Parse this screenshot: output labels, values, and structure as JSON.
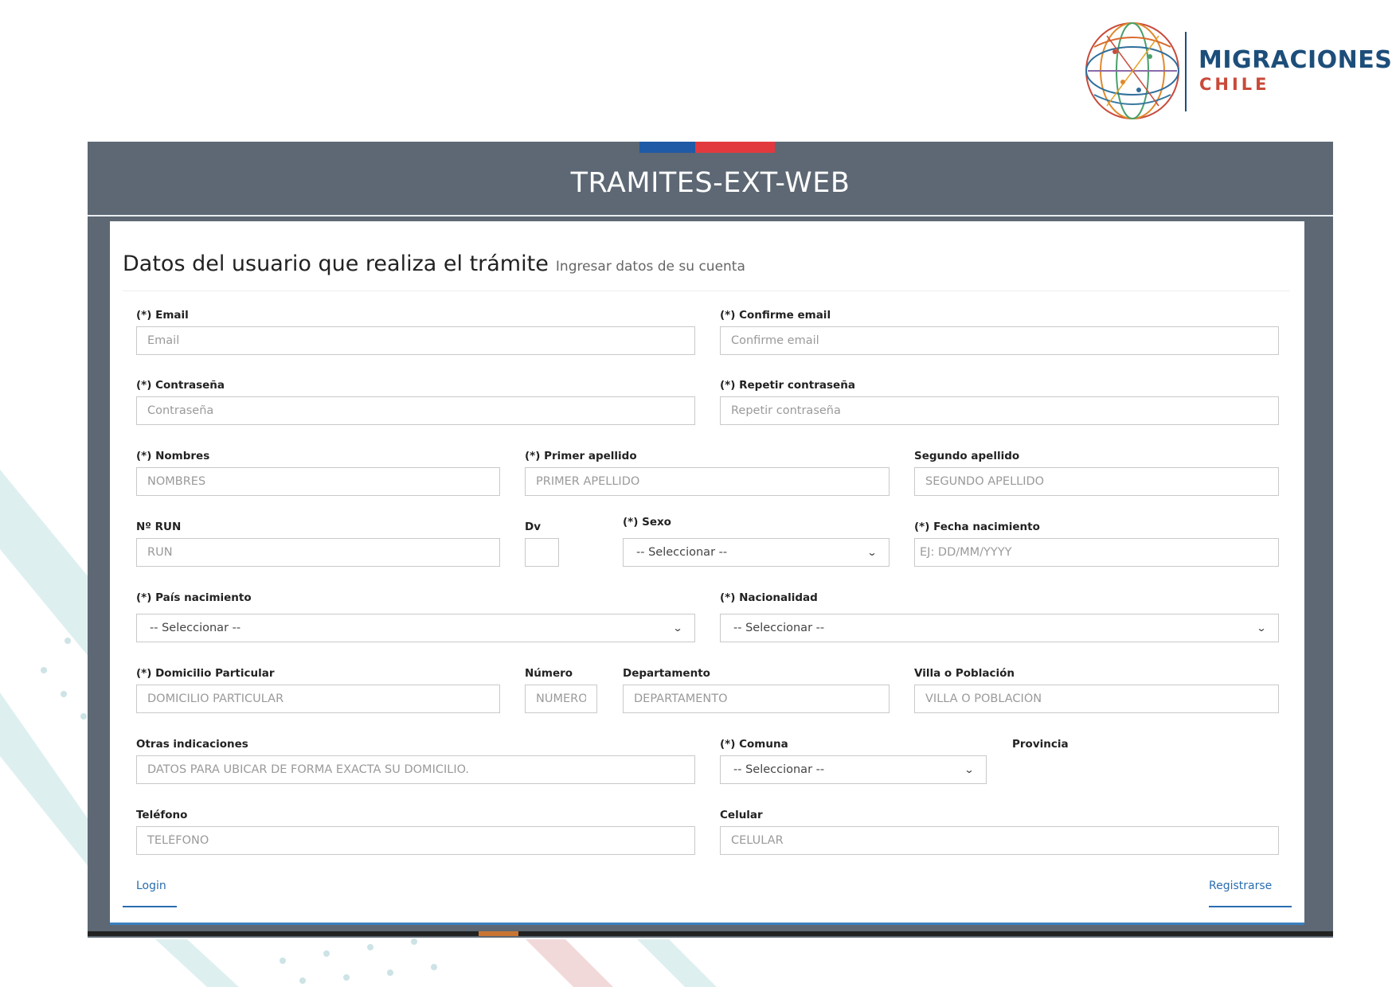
{
  "logo": {
    "line1": "MIGRACIONES",
    "line2": "CHILE"
  },
  "app": {
    "title": "TRAMITES-EXT-WEB"
  },
  "panel": {
    "title": "Datos del usuario que realiza el trámite",
    "subtitle": "Ingresar datos de su cuenta"
  },
  "form": {
    "email": {
      "label": "(*) Email",
      "placeholder": "Email"
    },
    "confirm_email": {
      "label": "(*) Confirme email",
      "placeholder": "Confirme email"
    },
    "password": {
      "label": "(*) Contraseña",
      "placeholder": "Contraseña"
    },
    "repeat_password": {
      "label": "(*) Repetir contraseña",
      "placeholder": "Repetir contraseña"
    },
    "nombres": {
      "label": "(*) Nombres",
      "placeholder": "NOMBRES"
    },
    "primer_apellido": {
      "label": "(*) Primer apellido",
      "placeholder": "PRIMER APELLIDO"
    },
    "segundo_apellido": {
      "label": "Segundo apellido",
      "placeholder": "SEGUNDO APELLIDO"
    },
    "run": {
      "label": "Nº RUN",
      "placeholder": "RUN"
    },
    "dv": {
      "label": "Dv",
      "placeholder": ""
    },
    "sexo": {
      "label": "(*) Sexo",
      "value": "-- Seleccionar --"
    },
    "fecha_nacimiento": {
      "label": "(*) Fecha nacimiento",
      "placeholder": "EJ: DD/MM/YYYY"
    },
    "pais_nacimiento": {
      "label": "(*) País nacimiento",
      "value": "-- Seleccionar --"
    },
    "nacionalidad": {
      "label": "(*) Nacionalidad",
      "value": "-- Seleccionar --"
    },
    "domicilio": {
      "label": "(*) Domicilio Particular",
      "placeholder": "DOMICILIO PARTICULAR"
    },
    "numero": {
      "label": "Número",
      "placeholder": "NÚMERO"
    },
    "departamento": {
      "label": "Departamento",
      "placeholder": "DEPARTAMENTO"
    },
    "villa": {
      "label": "Villa o Población",
      "placeholder": "VILLA O POBLACIÓN"
    },
    "otras": {
      "label": "Otras indicaciones",
      "placeholder": "DATOS PARA UBICAR DE FORMA EXACTA SU DOMICILIO."
    },
    "comuna": {
      "label": "(*) Comuna",
      "value": "-- Seleccionar --"
    },
    "provincia": {
      "label": "Provincia"
    },
    "telefono": {
      "label": "Teléfono",
      "placeholder": "TELÉFONO"
    },
    "celular": {
      "label": "Celular",
      "placeholder": "CELULAR"
    }
  },
  "actions": {
    "login": "Login",
    "register": "Registrarse"
  },
  "colors": {
    "frame": "#5d6874",
    "flag_blue": "#1e5aa6",
    "flag_red": "#e2393f",
    "link": "#2a6db0",
    "logo_blue": "#1d4e7a",
    "logo_red": "#c94a3a"
  }
}
